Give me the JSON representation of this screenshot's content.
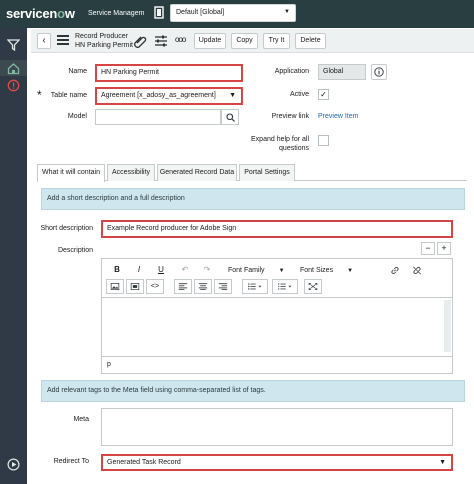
{
  "app": {
    "logo_prefix": "servicen",
    "logo_o": "o",
    "logo_suffix": "w",
    "title": "Service Managem",
    "scope": "Default [Global]"
  },
  "header": {
    "record_type": "Record Producer",
    "record_name": "HN Parking Permit",
    "buttons": {
      "update": "Update",
      "copy": "Copy",
      "try_it": "Try It",
      "delete": "Delete"
    },
    "more": "ooo"
  },
  "form": {
    "name_label": "Name",
    "name_value": "HN Parking Permit",
    "table_label": "Table name",
    "table_value": "Agreement [x_adosy_as_agreement]",
    "model_label": "Model",
    "model_value": "",
    "application_label": "Application",
    "application_value": "Global",
    "active_label": "Active",
    "active_check": "✓",
    "preview_label": "Preview link",
    "preview_value": "Preview Item",
    "expand_label_1": "Expand help for all",
    "expand_label_2": "questions"
  },
  "tabs": [
    "What it will contain",
    "Accessibility",
    "Generated Record Data",
    "Portal Settings"
  ],
  "section": {
    "info_description": "Add a short description and a full description",
    "short_desc_label": "Short description",
    "short_desc_value": "Example Record producer for Adobe Sign",
    "description_label": "Description",
    "minus": "−",
    "plus": "+",
    "editor": {
      "bold": "B",
      "italic": "I",
      "underline": "U",
      "font_family": "Font Family",
      "font_sizes": "Font Sizes",
      "status_p": "p",
      "code": "<>"
    },
    "info_tags": "Add relevant tags to the Meta field using comma-separated list of tags.",
    "meta_label": "Meta",
    "meta_value": "",
    "redirect_label": "Redirect To",
    "redirect_value": "Generated Task Record"
  },
  "colors": {
    "topbar": "#293e40",
    "nav": "#303a46",
    "highlight": "#d64545",
    "info": "#cfe6ee",
    "link": "#1e6bb8"
  }
}
